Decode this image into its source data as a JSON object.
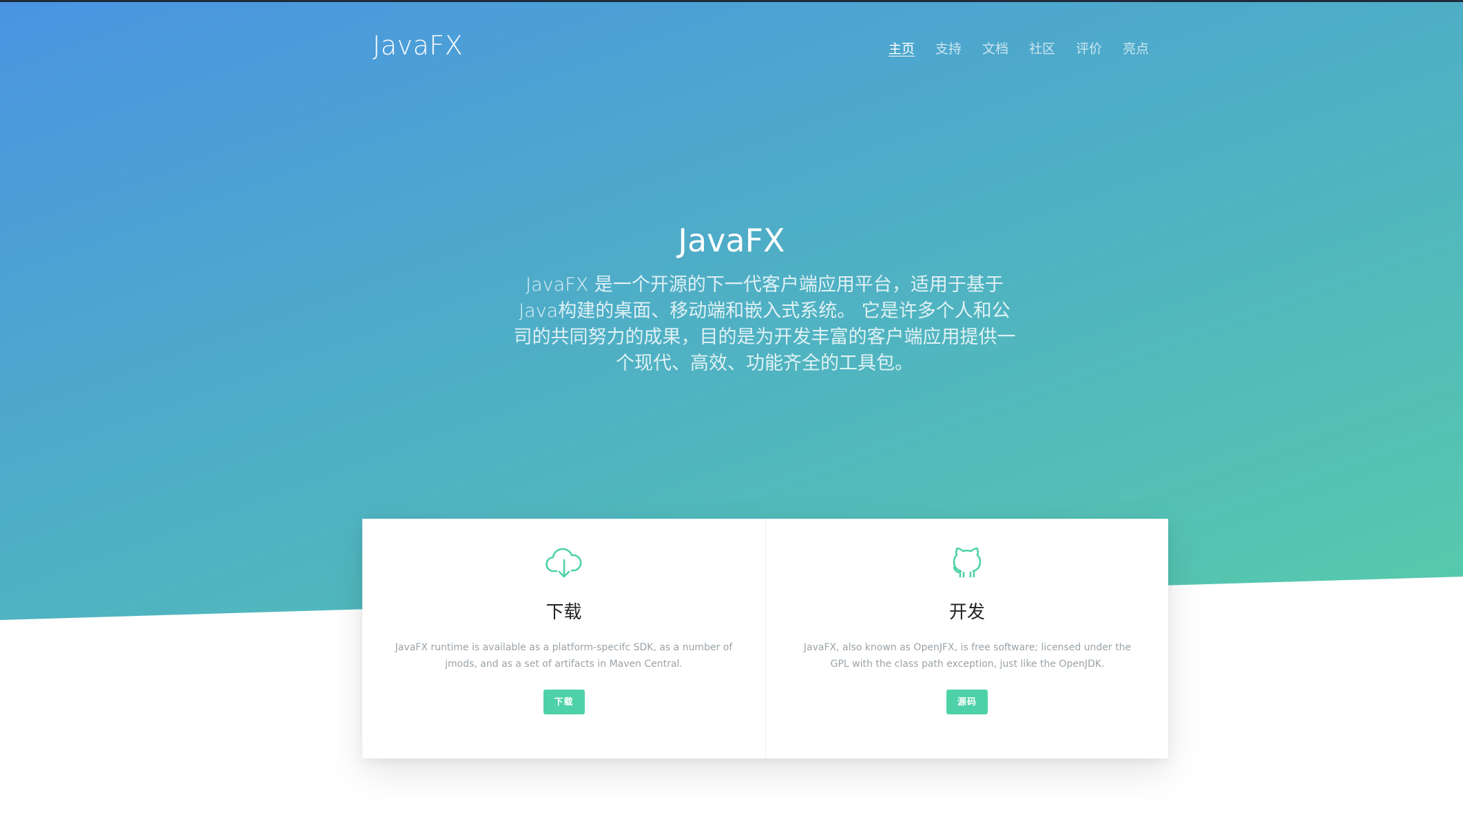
{
  "header": {
    "logo": "JavaFX",
    "nav": [
      "主页",
      "支持",
      "文档",
      "社区",
      "评价",
      "亮点"
    ]
  },
  "hero": {
    "title": "JavaFX",
    "description": "JavaFX 是一个开源的下一代客户端应用平台，适用于基于Java构建的桌面、移动端和嵌入式系统。 它是许多个人和公司的共同努力的成果，目的是为开发丰富的客户端应用提供一个现代、高效、功能齐全的工具包。"
  },
  "cards": [
    {
      "icon": "cloud-download-icon",
      "title": "下载",
      "text": "JavaFX runtime is available as a platform-specifc SDK, as a number of jmods, and as a set of artifacts in Maven Central.",
      "button": "下载"
    },
    {
      "icon": "github-icon",
      "title": "开发",
      "text": "JavaFX, also known as OpenJFX, is free software; licensed under the GPL with the class path exception, just like the OpenJDK.",
      "button": "源码"
    }
  ],
  "colors": {
    "gradient_start": "#4a94e2",
    "gradient_end": "#57cbab",
    "accent": "#4fd1a8"
  }
}
